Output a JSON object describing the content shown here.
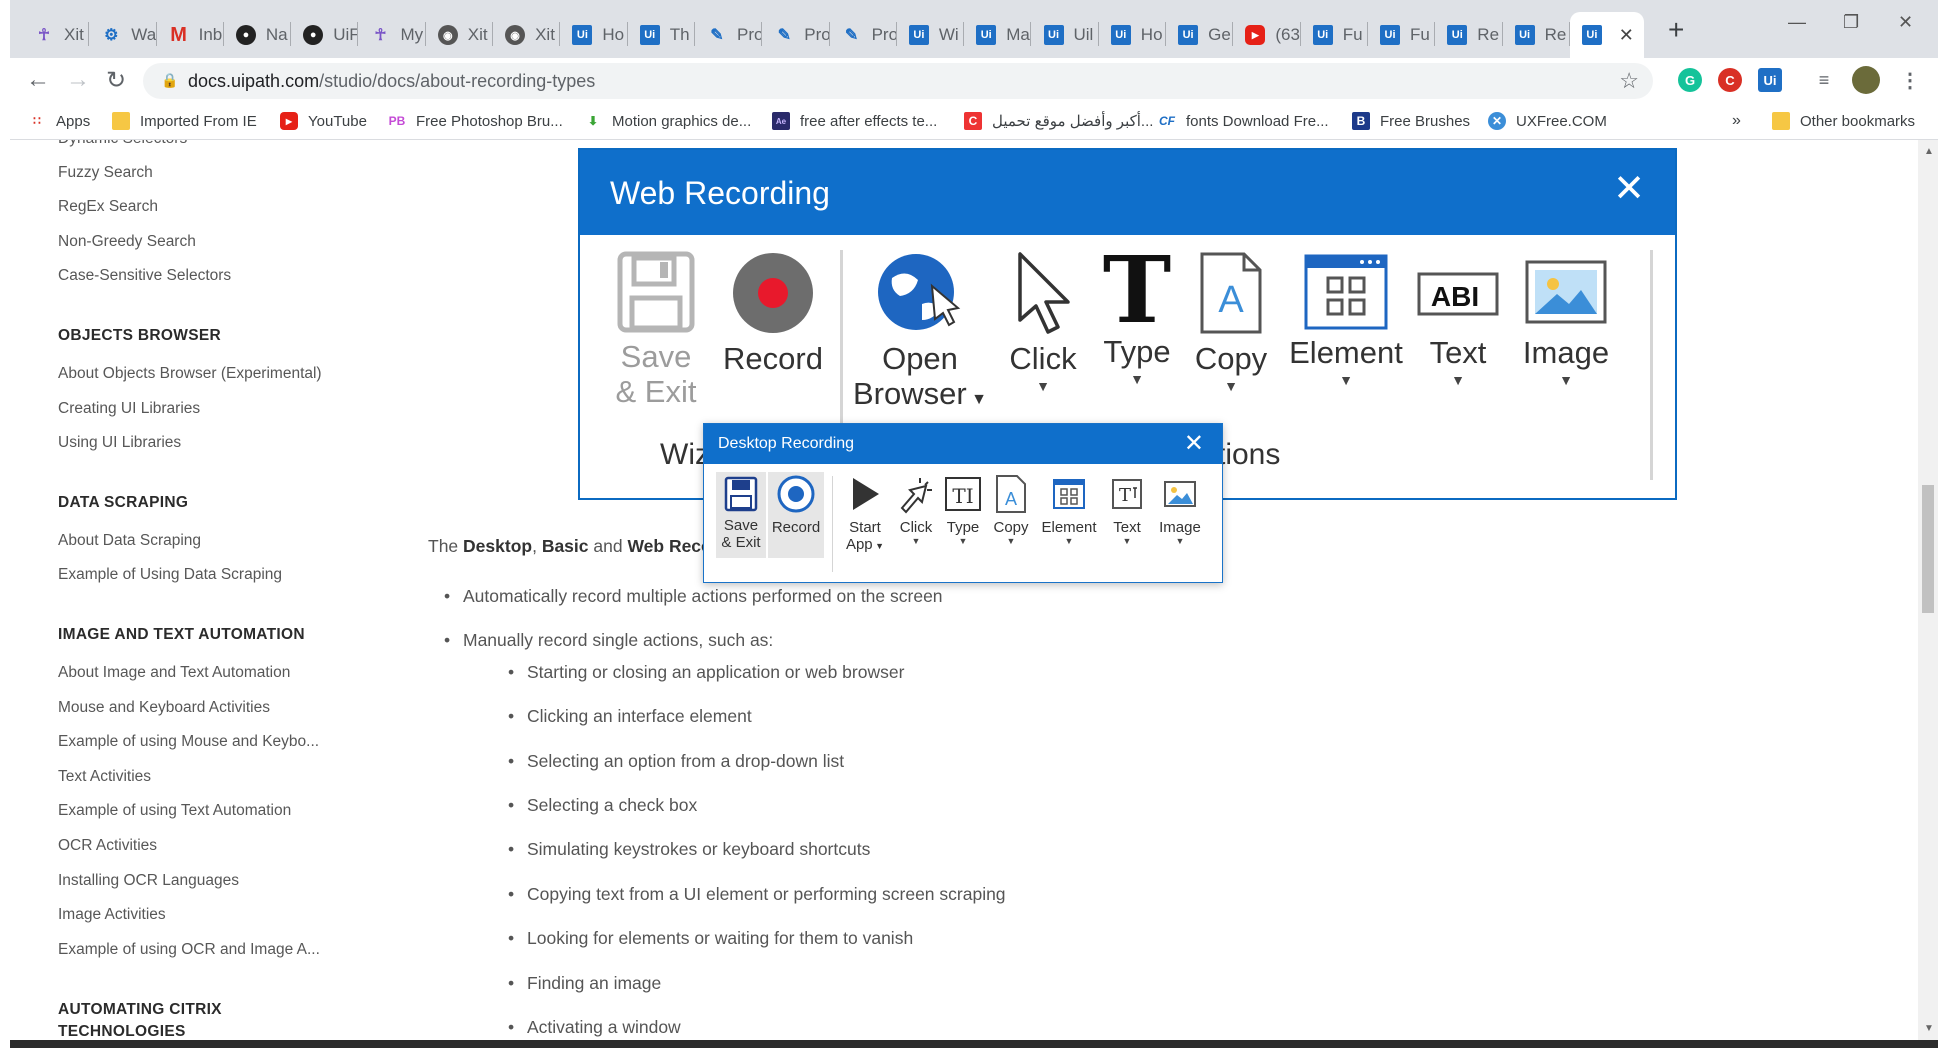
{
  "tabs": [
    {
      "label": "Xit",
      "icon": "xbox-icon"
    },
    {
      "label": "Wa",
      "icon": "robot-icon"
    },
    {
      "label": "Inb",
      "icon": "gmail-icon"
    },
    {
      "label": "Na",
      "icon": "github-icon"
    },
    {
      "label": "UiF",
      "icon": "github-icon"
    },
    {
      "label": "My",
      "icon": "xbox-icon"
    },
    {
      "label": "Xit",
      "icon": "chrome-icon"
    },
    {
      "label": "Xit",
      "icon": "chrome-icon"
    },
    {
      "label": "Ho",
      "icon": "uipath-icon"
    },
    {
      "label": "Th",
      "icon": "uipath-icon"
    },
    {
      "label": "Pro",
      "icon": "forum-icon"
    },
    {
      "label": "Pro",
      "icon": "forum-icon"
    },
    {
      "label": "Pro",
      "icon": "forum-icon"
    },
    {
      "label": "Wi",
      "icon": "uipath-icon"
    },
    {
      "label": "Ma",
      "icon": "uipath-icon"
    },
    {
      "label": "Uil",
      "icon": "uipath-icon"
    },
    {
      "label": "Ho",
      "icon": "uipath-icon"
    },
    {
      "label": "Ge",
      "icon": "uipath-icon"
    },
    {
      "label": "(63",
      "icon": "youtube-icon"
    },
    {
      "label": "Fu",
      "icon": "uipath-icon"
    },
    {
      "label": "Fu",
      "icon": "uipath-icon"
    },
    {
      "label": "Re",
      "icon": "uipath-icon"
    },
    {
      "label": "Re",
      "icon": "uipath-icon"
    },
    {
      "label": "",
      "icon": "uipath-icon",
      "active": true
    }
  ],
  "address": {
    "host": "docs.uipath.com",
    "path": "/studio/docs/about-recording-types"
  },
  "bookmarks": [
    "Apps",
    "Imported From IE",
    "YouTube",
    "Free Photoshop Bru...",
    "Motion graphics de...",
    "free after effects te...",
    "أكبر وأفضل موقع تحميل...",
    "fonts Download Fre...",
    "Free Brushes",
    "UXFree.COM",
    "Other bookmarks"
  ],
  "sidebar": {
    "top_items": [
      "Dynamic Selectors",
      "Fuzzy Search",
      "RegEx Search",
      "Non-Greedy Search",
      "Case-Sensitive Selectors"
    ],
    "objects_browser": {
      "heading": "OBJECTS BROWSER",
      "items": [
        "About Objects Browser (Experimental)",
        "Creating UI Libraries",
        "Using UI Libraries"
      ]
    },
    "data_scraping": {
      "heading": "DATA SCRAPING",
      "items": [
        "About Data Scraping",
        "Example of Using Data Scraping"
      ]
    },
    "image_text": {
      "heading": "IMAGE AND TEXT AUTOMATION",
      "items": [
        "About Image and Text Automation",
        "Mouse and Keyboard Activities",
        "Example of using Mouse and Keybo...",
        "Text Activities",
        "Example of using Text Automation",
        "OCR Activities",
        "Installing OCR Languages",
        "Image Activities",
        "Example of using OCR and Image A..."
      ]
    },
    "citrix": {
      "heading_line1": "AUTOMATING CITRIX",
      "heading_line2": "TECHNOLOGIES"
    }
  },
  "content": {
    "intro": {
      "prefix": "The ",
      "desktop": "Desktop",
      "comma": ", ",
      "basic": "Basic",
      "and": " and ",
      "web": "Web Reco"
    },
    "bullets": [
      "Automatically record multiple actions performed on the screen",
      "Manually record single actions, such as:"
    ],
    "subbullets": [
      "Starting or closing an application or web browser",
      "Clicking an interface element",
      "Selecting an option from a drop-down list",
      "Selecting a check box",
      "Simulating keystrokes or keyboard shortcuts",
      "Copying text from a UI element or performing screen scraping",
      "Looking for elements or waiting for them to vanish",
      "Finding an image",
      "Activating a window"
    ]
  },
  "web_recording": {
    "title": "Web Recording",
    "save_line1": "Save",
    "save_line2": "& Exit",
    "record": "Record",
    "open_line1": "Open",
    "open_line2": "Browser",
    "click": "Click",
    "type": "Type",
    "copy": "Copy",
    "element": "Element",
    "text": "Text",
    "image": "Image",
    "group_left": "Wiz",
    "group_right": "tions"
  },
  "desktop_recording": {
    "title": "Desktop Recording",
    "save_line1": "Save",
    "save_line2": "& Exit",
    "record": "Record",
    "start_line1": "Start",
    "start_line2": "App",
    "click": "Click",
    "type": "Type",
    "copy": "Copy",
    "element": "Element",
    "text": "Text",
    "image": "Image"
  },
  "colors": {
    "uipath_blue": "#0f6fcb",
    "record_red": "#e8192c"
  }
}
